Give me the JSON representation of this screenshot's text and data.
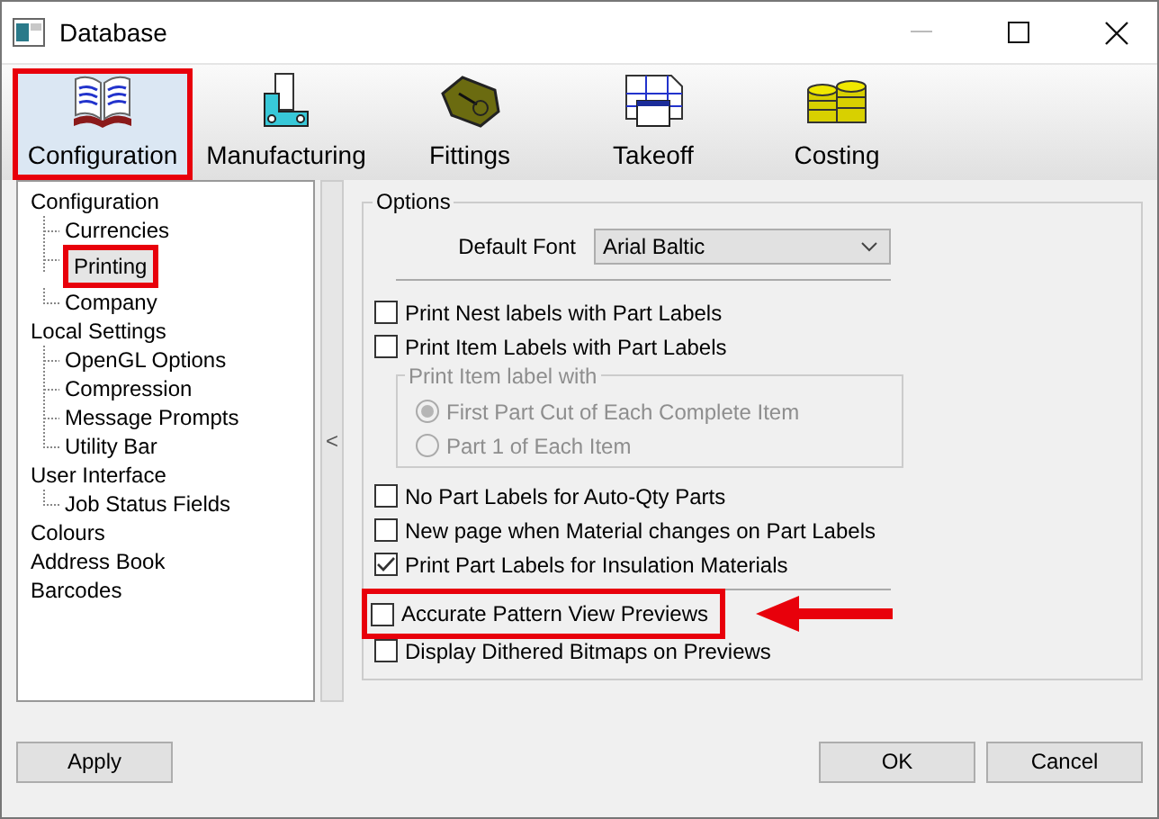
{
  "window": {
    "title": "Database"
  },
  "tabs": [
    {
      "label": "Configuration",
      "selected": true,
      "highlighted": true
    },
    {
      "label": "Manufacturing",
      "selected": false,
      "highlighted": false
    },
    {
      "label": "Fittings",
      "selected": false,
      "highlighted": false
    },
    {
      "label": "Takeoff",
      "selected": false,
      "highlighted": false
    },
    {
      "label": "Costing",
      "selected": false,
      "highlighted": false
    }
  ],
  "tree": [
    {
      "label": "Configuration",
      "selected": false,
      "highlighted": false,
      "children": [
        {
          "label": "Currencies",
          "selected": false,
          "highlighted": false
        },
        {
          "label": "Printing",
          "selected": true,
          "highlighted": true
        },
        {
          "label": "Company",
          "selected": false,
          "highlighted": false
        }
      ]
    },
    {
      "label": "Local Settings",
      "selected": false,
      "highlighted": false,
      "children": [
        {
          "label": "OpenGL Options",
          "selected": false,
          "highlighted": false
        },
        {
          "label": "Compression",
          "selected": false,
          "highlighted": false
        },
        {
          "label": "Message Prompts",
          "selected": false,
          "highlighted": false
        },
        {
          "label": "Utility Bar",
          "selected": false,
          "highlighted": false
        }
      ]
    },
    {
      "label": "User Interface",
      "selected": false,
      "highlighted": false,
      "children": [
        {
          "label": "Job Status Fields",
          "selected": false,
          "highlighted": false
        }
      ]
    },
    {
      "label": "Colours",
      "selected": false,
      "highlighted": false
    },
    {
      "label": "Address Book",
      "selected": false,
      "highlighted": false
    },
    {
      "label": "Barcodes",
      "selected": false,
      "highlighted": false
    }
  ],
  "collapse_button": "<",
  "options": {
    "title": "Options",
    "default_font": {
      "label": "Default Font",
      "value": "Arial Baltic"
    },
    "items": [
      {
        "kind": "checkbox",
        "label": "Print Nest labels with Part Labels",
        "checked": false,
        "highlighted": false
      },
      {
        "kind": "checkbox",
        "label": "Print Item Labels with Part Labels",
        "checked": false,
        "highlighted": false
      },
      {
        "kind": "radio_group",
        "title": "Print Item label with",
        "disabled": true,
        "options": [
          {
            "label": "First Part Cut of Each Complete Item",
            "selected": true
          },
          {
            "label": "Part 1 of Each Item",
            "selected": false
          }
        ]
      },
      {
        "kind": "checkbox",
        "label": "No Part Labels for Auto-Qty Parts",
        "checked": false,
        "highlighted": false
      },
      {
        "kind": "checkbox",
        "label": "New page when Material changes on Part Labels",
        "checked": false,
        "highlighted": false
      },
      {
        "kind": "checkbox",
        "label": "Print Part Labels for Insulation Materials",
        "checked": true,
        "highlighted": false
      }
    ],
    "preview_items": [
      {
        "kind": "checkbox",
        "label": "Accurate Pattern View Previews",
        "checked": false,
        "highlighted": true
      },
      {
        "kind": "checkbox",
        "label": "Display Dithered Bitmaps on Previews",
        "checked": false,
        "highlighted": false
      }
    ]
  },
  "buttons": {
    "apply": "Apply",
    "ok": "OK",
    "cancel": "Cancel"
  }
}
